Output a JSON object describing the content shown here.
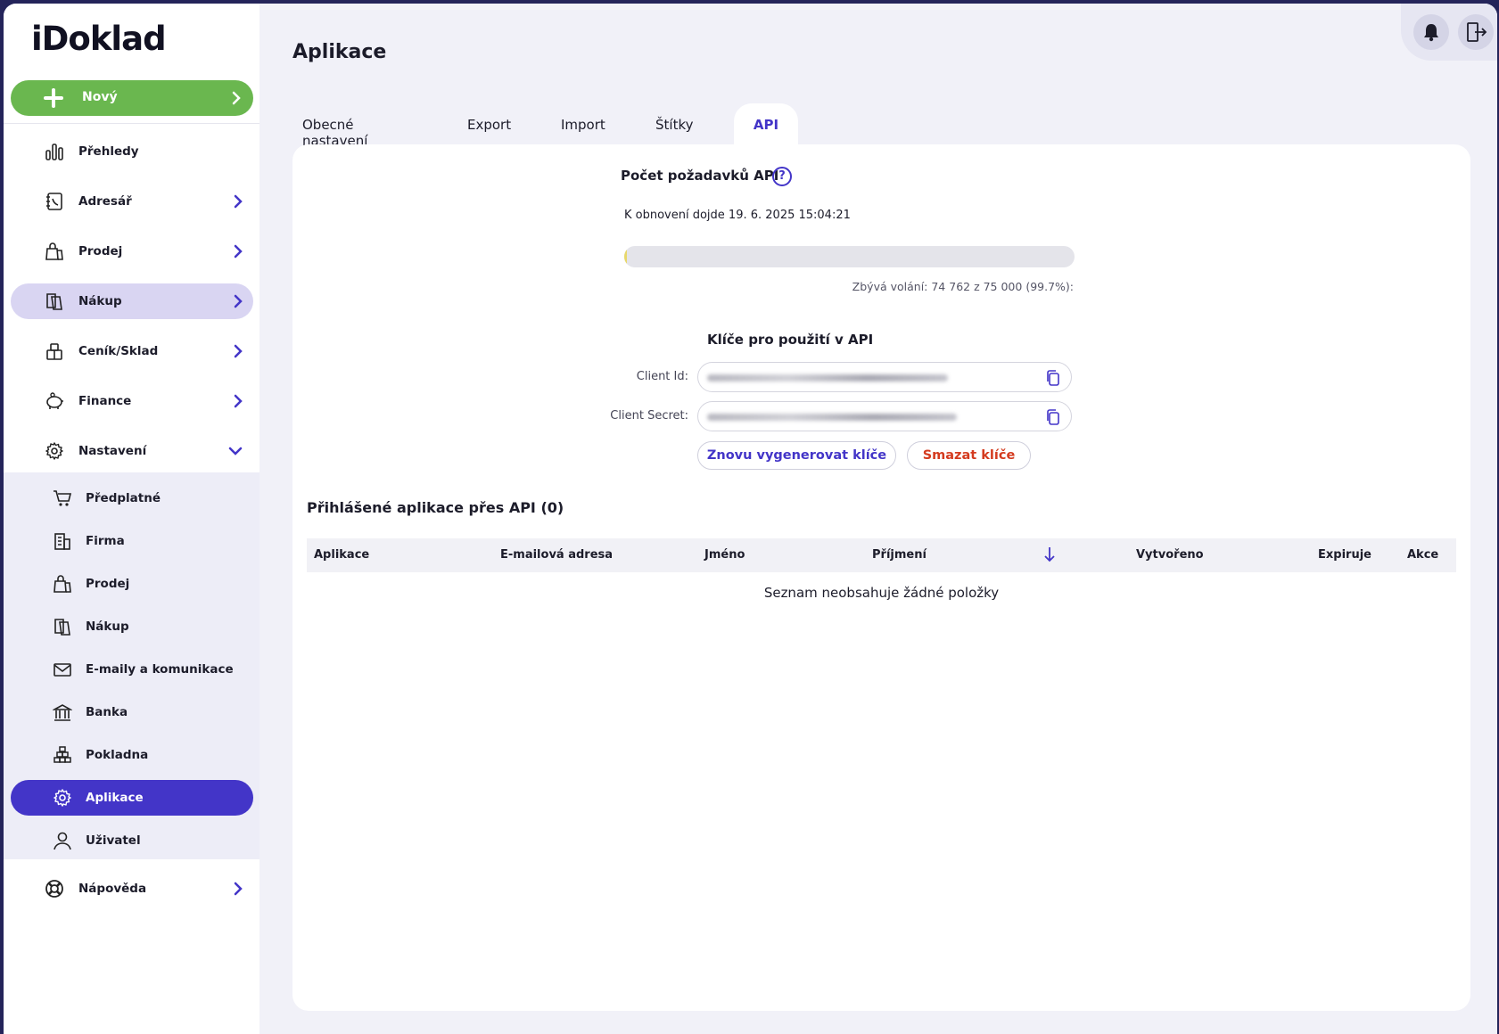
{
  "app": {
    "logo": "iDoklad"
  },
  "sidebar": {
    "new_button": "Nový",
    "items": [
      {
        "label": "Přehledy",
        "icon": "chart-bars-icon"
      },
      {
        "label": "Adresář",
        "icon": "address-book-icon"
      },
      {
        "label": "Prodej",
        "icon": "shopping-bag-icon"
      },
      {
        "label": "Nákup",
        "icon": "purchase-icon"
      },
      {
        "label": "Ceník/Sklad",
        "icon": "warehouse-icon"
      },
      {
        "label": "Finance",
        "icon": "piggy-bank-icon"
      },
      {
        "label": "Nastavení",
        "icon": "gear-icon"
      }
    ],
    "sub_items": [
      {
        "label": "Předplatné",
        "icon": "cart-icon"
      },
      {
        "label": "Firma",
        "icon": "building-icon"
      },
      {
        "label": "Prodej",
        "icon": "shopping-bag-icon"
      },
      {
        "label": "Nákup",
        "icon": "purchase-icon"
      },
      {
        "label": "E-maily a komunikace",
        "icon": "envelope-icon"
      },
      {
        "label": "Banka",
        "icon": "bank-icon"
      },
      {
        "label": "Pokladna",
        "icon": "coins-icon"
      },
      {
        "label": "Aplikace",
        "icon": "gear-icon"
      },
      {
        "label": "Uživatel",
        "icon": "user-icon"
      }
    ],
    "help": {
      "label": "Nápověda",
      "icon": "lifebuoy-icon"
    }
  },
  "header": {
    "title": "Aplikace"
  },
  "tabs": [
    {
      "label": "Obecné nastavení"
    },
    {
      "label": "Export"
    },
    {
      "label": "Import"
    },
    {
      "label": "Štítky"
    },
    {
      "label": "API"
    }
  ],
  "api": {
    "requests_title": "Počet požadavků API",
    "renewal_text": "K obnovení dojde 19. 6. 2025 15:04:21",
    "usage_fraction_used": 0.003,
    "remaining_text": "Zbývá volání: 74 762 z 75 000 (99.7%):",
    "keys_title": "Klíče pro použití v API",
    "client_id_label": "Client Id:",
    "client_secret_label": "Client Secret:",
    "regenerate_button": "Znovu vygenerovat klíče",
    "delete_button": "Smazat klíče"
  },
  "apps_table": {
    "title": "Přihlášené aplikace přes API (0)",
    "columns": [
      "Aplikace",
      "E-mailová adresa",
      "Jméno",
      "Příjmení",
      "Vytvořeno",
      "Expiruje",
      "Akce"
    ],
    "empty_text": "Seznam neobsahuje žádné položky"
  },
  "colors": {
    "accent": "#4335c8",
    "new_button": "#6ab74f",
    "danger": "#d43b1f"
  }
}
